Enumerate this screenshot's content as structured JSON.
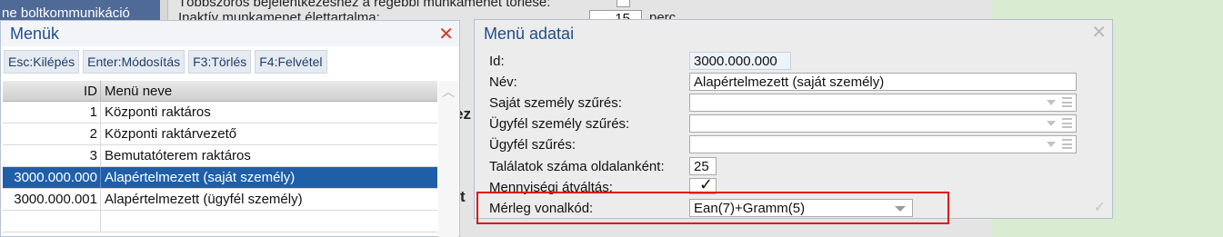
{
  "background": {
    "left_strip_text": "ne boltkommunikáció",
    "line1_text": "Többszörös bejelentkezéshez a régebbi munkamenet törlése:",
    "line2_text": "Inaktív munkamenet élettartalma:",
    "session_minutes": "15",
    "session_unit": "perc",
    "ghost1": "ez",
    "ghost2": "t"
  },
  "menuk": {
    "title": "Menük",
    "toolbar": [
      {
        "key": "Esc:",
        "label": "Kilépés"
      },
      {
        "key": "Enter:",
        "label": "Módosítás"
      },
      {
        "key": "F3:",
        "label": "Törlés"
      },
      {
        "key": "F4:",
        "label": "Felvétel"
      }
    ],
    "columns": [
      "ID",
      "Menü neve"
    ],
    "rows": [
      {
        "id": "1",
        "name": "Központi raktáros"
      },
      {
        "id": "2",
        "name": "Központi raktárvezető"
      },
      {
        "id": "3",
        "name": "Bemutatóterem raktáros"
      },
      {
        "id": "3000.000.000",
        "name": "Alapértelmezett (saját személy)"
      },
      {
        "id": "3000.000.001",
        "name": "Alapértelmezett (ügyfél személy)"
      },
      {
        "id": "",
        "name": ""
      }
    ],
    "selected_row": 3
  },
  "adatai": {
    "title": "Menü adatai",
    "fields": {
      "id_label": "Id:",
      "id_value": "3000.000.000",
      "nev_label": "Név:",
      "nev_value": "Alapértelmezett (saját személy)",
      "sajat_label": "Saját személy szűrés:",
      "ugyfel_szemely_label": "Ügyfél személy szűrés:",
      "ugyfel_label": "Ügyfél szűrés:",
      "talalatok_label": "Találatok száma oldalanként:",
      "talalatok_value": "25",
      "mennyisegi_label": "Mennyiségi átváltás:",
      "mennyisegi_checked": true,
      "merleg_label": "Mérleg vonalkód:",
      "merleg_value": "Ean(7)+Gramm(5)"
    },
    "highlight_color": "#e0131b",
    "accent_color": "#1f5fa8"
  }
}
